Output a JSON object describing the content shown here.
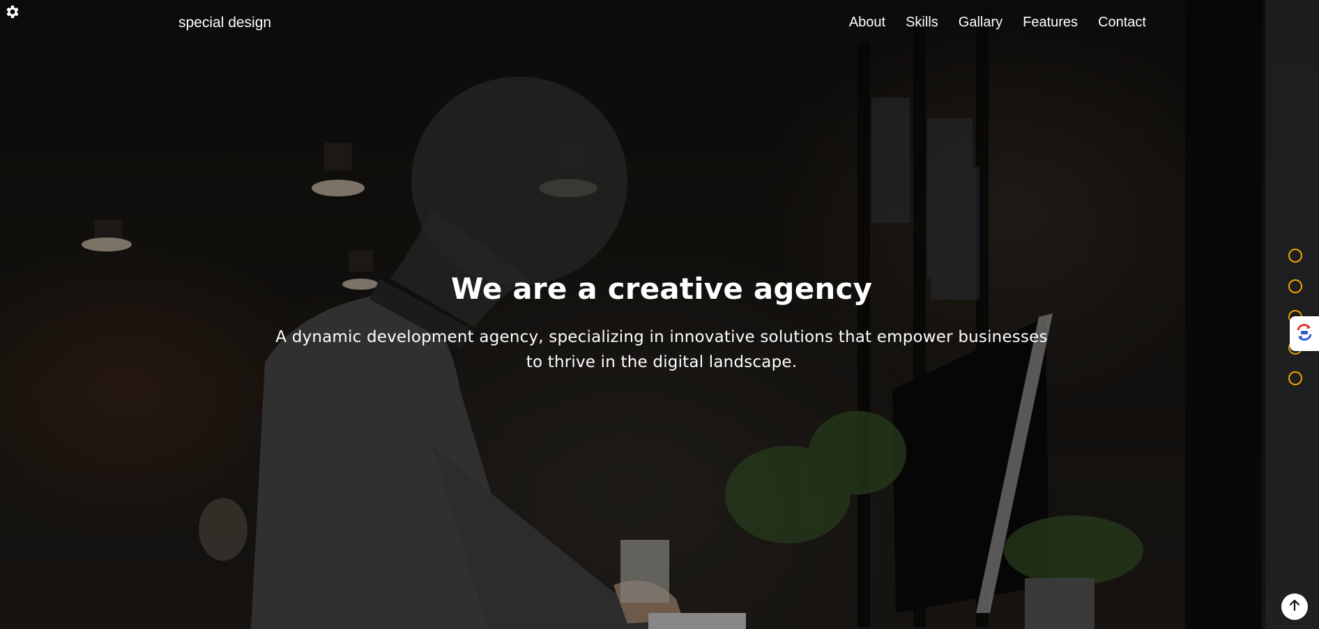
{
  "header": {
    "logo": "special design",
    "nav": [
      "About",
      "Skills",
      "Gallary",
      "Features",
      "Contact"
    ]
  },
  "hero": {
    "title": "We are a creative agency",
    "subtitle": "A dynamic development agency, specializing in innovative solutions that empower businesses to thrive in the digital landscape."
  },
  "icons": {
    "settings": "gear-icon",
    "translate": "translate-icon",
    "scroll_top": "arrow-up-icon"
  },
  "colors": {
    "accent": "#f0a500",
    "text": "#ffffff"
  },
  "bullets_count": 5
}
